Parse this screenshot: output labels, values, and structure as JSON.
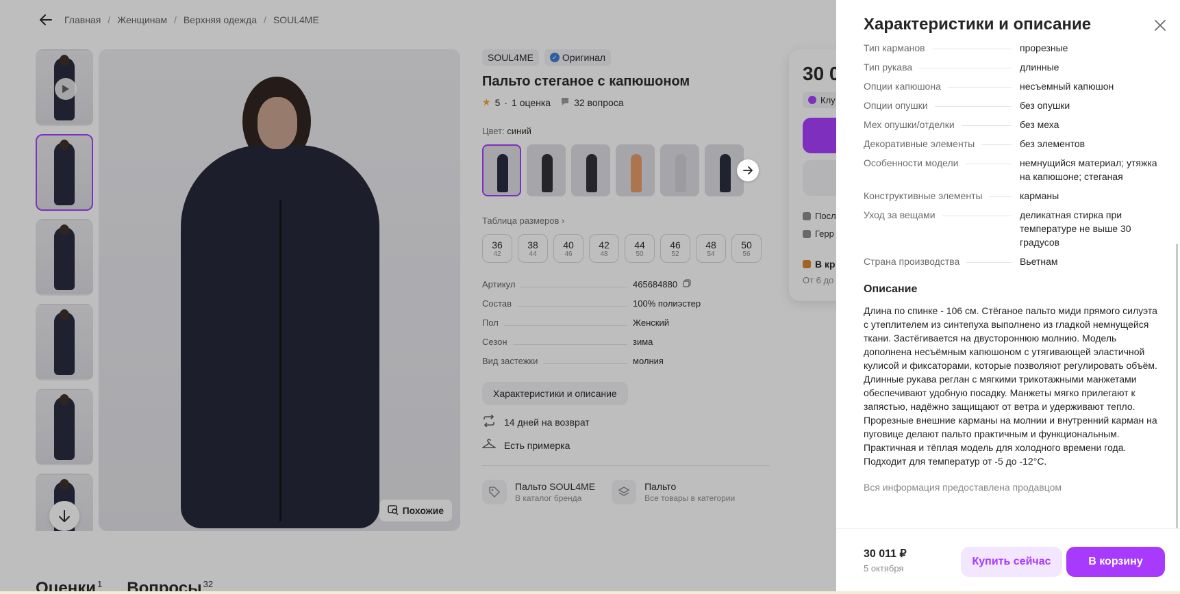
{
  "breadcrumb": {
    "items": [
      "Главная",
      "Женщинам",
      "Верхняя одежда",
      "SOUL4ME"
    ],
    "separator": "/"
  },
  "product": {
    "brand": "SOUL4ME",
    "original_badge": "Оригинал",
    "title": "Пальто стеганое с капюшоном",
    "rating": "5",
    "rating_sep": "·",
    "reviews_count": "1 оценка",
    "questions_count": "32 вопроса",
    "color_label": "Цвет:",
    "color_value": "синий",
    "size_table_label": "Таблица размеров",
    "sizes": [
      {
        "main": "36",
        "sub": "42"
      },
      {
        "main": "38",
        "sub": "44"
      },
      {
        "main": "40",
        "sub": "46"
      },
      {
        "main": "42",
        "sub": "48"
      },
      {
        "main": "44",
        "sub": "50"
      },
      {
        "main": "46",
        "sub": "52"
      },
      {
        "main": "48",
        "sub": "54"
      },
      {
        "main": "50",
        "sub": "56"
      }
    ],
    "specs": [
      {
        "k": "Артикул",
        "v": "465684880"
      },
      {
        "k": "Состав",
        "v": "100% полиэстер"
      },
      {
        "k": "Пол",
        "v": "Женский"
      },
      {
        "k": "Сезон",
        "v": "зима"
      },
      {
        "k": "Вид застежки",
        "v": "молния"
      }
    ],
    "char_button": "Характеристики и описание",
    "perks": [
      "14 дней на возврат",
      "Есть примерка"
    ],
    "brand_links": [
      {
        "title": "Пальто SOUL4ME",
        "sub": "В каталог бренда"
      },
      {
        "title": "Пальто",
        "sub": "Все товары в категории"
      }
    ],
    "similar_label": "Похожие",
    "swatch_colors": [
      "#23263a",
      "#2a2a30",
      "#2c2c33",
      "#e79a63",
      "#cfcfd4",
      "#25283a"
    ]
  },
  "buy_card": {
    "price_partial": "30 0",
    "club_partial": "Клу",
    "line1": "Посл",
    "line2": "Герр",
    "cart_partial": "В кр",
    "from_partial": "От 6 до"
  },
  "tabs": [
    {
      "label": "Оценки",
      "count": "1"
    },
    {
      "label": "Вопросы",
      "count": "32"
    }
  ],
  "drawer": {
    "title": "Характеристики и описание",
    "characteristics": [
      {
        "k": "Тип карманов",
        "v": "прорезные"
      },
      {
        "k": "Тип рукава",
        "v": "длинные"
      },
      {
        "k": "Опции капюшона",
        "v": "несъемный капюшон"
      },
      {
        "k": "Опции опушки",
        "v": "без опушки"
      },
      {
        "k": "Мех опушки/отделки",
        "v": "без меха"
      },
      {
        "k": "Декоративные элементы",
        "v": "без элементов"
      },
      {
        "k": "Особенности модели",
        "v": "немнущийся материал; утяжка на капюшоне; стеганая"
      },
      {
        "k": "Конструктивные элементы",
        "v": "карманы"
      },
      {
        "k": "Уход за вещами",
        "v": "деликатная стирка при температуре не выше 30 градусов"
      },
      {
        "k": "Страна производства",
        "v": "Вьетнам"
      }
    ],
    "description_title": "Описание",
    "description": "Длина по спинке - 106 см. Стёганое пальто миди прямого силуэта с утеплителем из синтепуха выполнено из гладкой немнущейся ткани. Застёгивается на двустороннюю молнию. Модель дополнена несъёмным капюшоном с утягивающей эластичной кулисой и фиксаторами, которые позволяют регулировать объём. Длинные рукава реглан с мягкими трикотажными манжетами обеспечивают удобную посадку. Манжеты мягко прилегают к запястью, надёжно защищают от ветра и удерживают тепло. Прорезные внешние карманы на молнии и внутренний карман на пуговице делают пальто практичным и функциональным. Практичная и тёплая модель для холодного времени года. Подходит для температур от -5 до -12°C.",
    "disclaimer": "Вся информация предоставлена продавцом",
    "footer": {
      "price": "30 011 ₽",
      "date": "5 октября",
      "buy_now": "Купить сейчас",
      "add_to_cart": "В корзину"
    }
  },
  "colors": {
    "accent": "#a73afd",
    "accent_light": "#f3e6ff",
    "text": "#242424",
    "muted": "#6b6b6b"
  }
}
